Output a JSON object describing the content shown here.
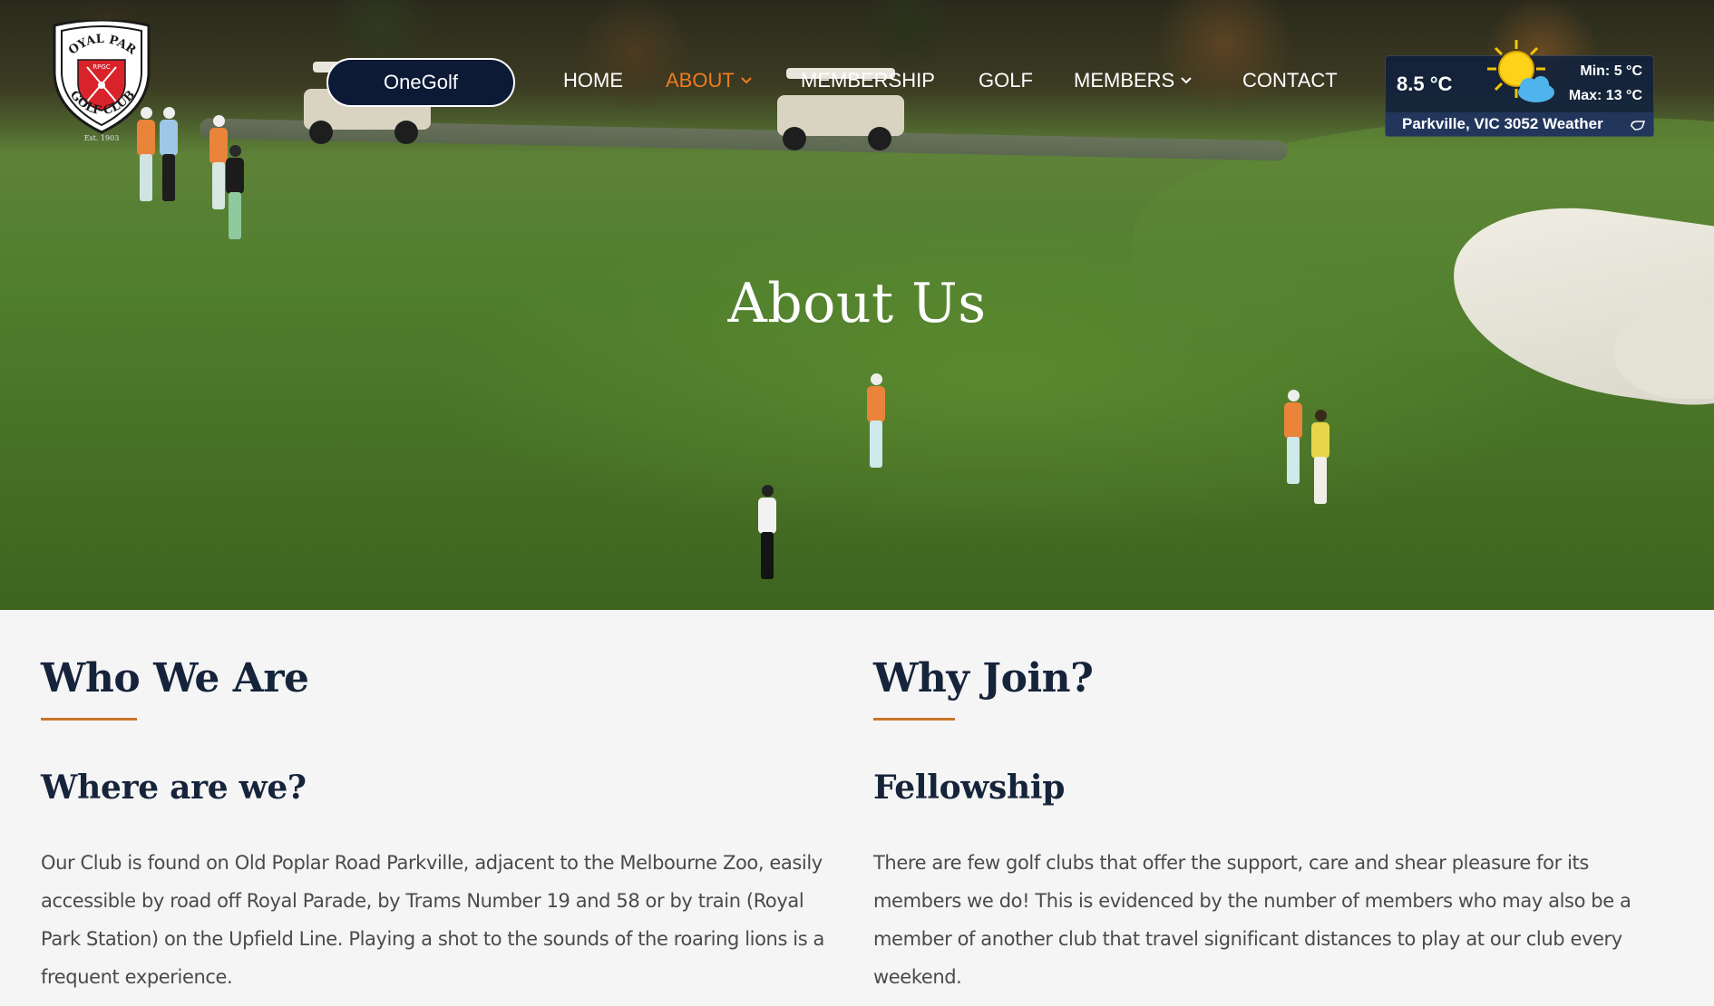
{
  "logo": {
    "text_top": "ROYAL PARK",
    "text_bottom": "GOLF CLUB",
    "badge": "RPGC",
    "established": "Est. 1903"
  },
  "nav": {
    "onegolf_label": "OneGolf",
    "items": [
      {
        "label": "HOME",
        "active": false,
        "dropdown": false
      },
      {
        "label": "ABOUT",
        "active": true,
        "dropdown": true
      },
      {
        "label": "MEMBERSHIP",
        "active": false,
        "dropdown": false
      },
      {
        "label": "GOLF",
        "active": false,
        "dropdown": false
      },
      {
        "label": "MEMBERS",
        "active": false,
        "dropdown": true
      },
      {
        "label": "CONTACT",
        "active": false,
        "dropdown": false
      }
    ],
    "active_color": "#f07b1e"
  },
  "weather": {
    "temp": "8.5 °C",
    "min": "Min: 5 °C",
    "max": "Max: 13 °C",
    "location": "Parkville, VIC 3052 Weather",
    "icon": "sun-cloud-icon"
  },
  "hero": {
    "title": "About Us"
  },
  "left": {
    "heading": "Who We Are",
    "subheading": "Where are we?",
    "paragraph": "Our Club is found on Old Poplar Road Parkville, adjacent to the Melbourne Zoo, easily accessible by road off Royal Parade, by Trams Number 19 and 58 or by train (Royal Park Station) on the Upfield Line. Playing a shot to the sounds of the roaring lions is a frequent experience."
  },
  "right": {
    "heading": "Why Join?",
    "subheading": "Fellowship",
    "paragraph": "There are few golf clubs that offer the support, care and shear pleasure for its members we do! This is evidenced by the number of members who may also be a member of another club that travel significant distances to play at our club every weekend."
  },
  "colors": {
    "navy": "#0c1a36",
    "accent": "#c8752a",
    "text": "#4a4a4a",
    "heading": "#16243b"
  }
}
